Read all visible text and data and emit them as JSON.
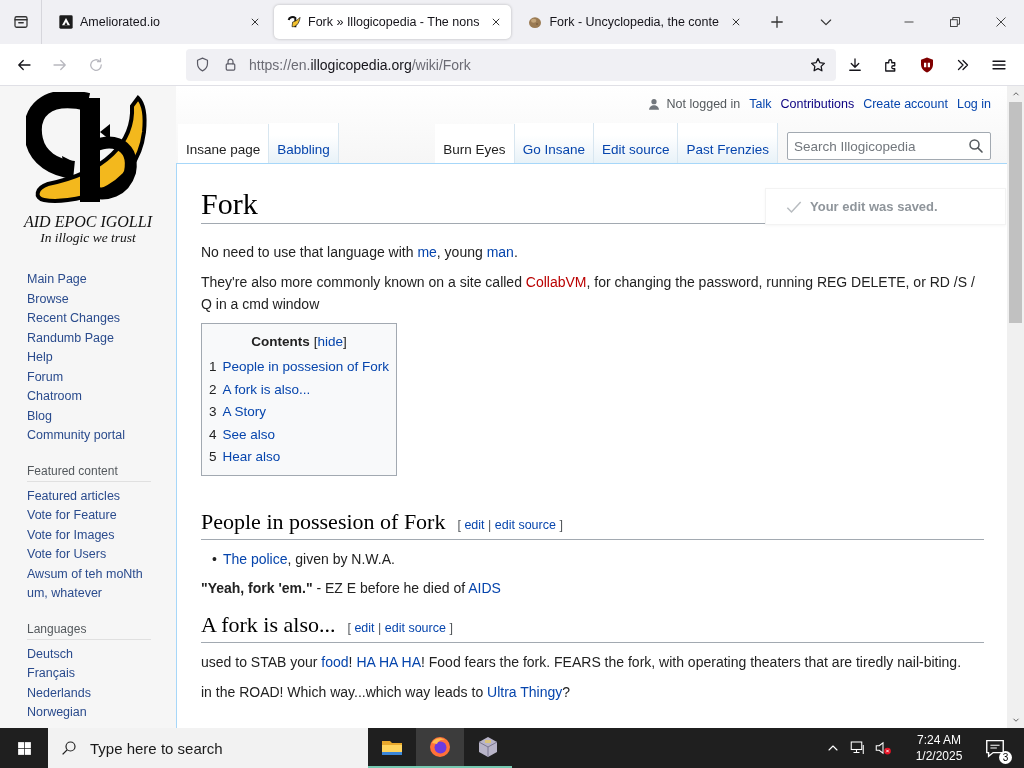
{
  "browser": {
    "tabs": [
      {
        "kind": "ameliorated",
        "title": "Ameliorated.io",
        "selected": false
      },
      {
        "kind": "illogicopedia",
        "title": "Fork » Illogicopedia - The nons",
        "selected": true
      },
      {
        "kind": "uncyclopedia",
        "title": "Fork - Uncyclopedia, the conte",
        "selected": false
      }
    ],
    "nav_buttons": [
      {
        "kind": "back",
        "disabled": false
      },
      {
        "kind": "forward",
        "disabled": true
      },
      {
        "kind": "reload",
        "disabled": true
      }
    ],
    "address": {
      "prefix": "https://en.",
      "domain": "illogicopedia.org",
      "path": "/wiki/Fork"
    }
  },
  "wiki": {
    "logo": {
      "title": "AID EPOC IGOLLI",
      "motto": "In illogic we trust"
    },
    "navigation": [
      "Main Page",
      "Browse",
      "Recent Changes",
      "Randumb Page",
      "Help",
      "Forum",
      "Chatroom",
      "Blog",
      "Community portal"
    ],
    "portlets": [
      {
        "heading": "Featured content",
        "items": [
          "Featured articles",
          "Vote for Feature",
          "Vote for Images",
          "Vote for Users",
          "Awsum of teh moNth",
          "um, whatever"
        ]
      },
      {
        "heading": "Languages",
        "items": [
          "Deutsch",
          "Français",
          "Nederlands",
          "Norwegian"
        ]
      }
    ],
    "personal": {
      "status": "Not logged in",
      "links": [
        {
          "label": "Talk",
          "visited": false
        },
        {
          "label": "Contributions",
          "visited": true
        },
        {
          "label": "Create account",
          "visited": false
        },
        {
          "label": "Log in",
          "visited": false
        }
      ]
    },
    "namespace_tabs": [
      {
        "label": "Insane page",
        "selected": true
      },
      {
        "label": "Babbling",
        "selected": false
      }
    ],
    "view_tabs": [
      {
        "label": "Burn Eyes",
        "selected": true
      },
      {
        "label": "Go Insane",
        "selected": false
      },
      {
        "label": "Edit source",
        "selected": false
      },
      {
        "label": "Past Frenzies",
        "selected": false
      }
    ],
    "search": {
      "placeholder": "Search Illogicopedia"
    },
    "notification": "Your edit was saved.",
    "article": {
      "title": "Fork",
      "blocks": [
        {
          "kind": "paragraph",
          "segments": [
            {
              "kind": "text",
              "text": "No need to use that language with "
            },
            {
              "kind": "link",
              "text": "me"
            },
            {
              "kind": "text",
              "text": ", young "
            },
            {
              "kind": "link",
              "text": "man"
            },
            {
              "kind": "text",
              "text": "."
            }
          ]
        },
        {
          "kind": "paragraph",
          "segments": [
            {
              "kind": "text",
              "text": "They're also more commonly known on a site called "
            },
            {
              "kind": "redlink",
              "text": "CollabVM"
            },
            {
              "kind": "text",
              "text": ", for changing the password, running REG DELETE, or RD /S / Q in a cmd window"
            }
          ]
        },
        {
          "kind": "toc",
          "title": "Contents",
          "toggle": {
            "open": "[",
            "label": "hide",
            "close": "]"
          },
          "items": [
            {
              "number": "1",
              "label": "People in possesion of Fork"
            },
            {
              "number": "2",
              "label": "A fork is also..."
            },
            {
              "number": "3",
              "label": "A Story"
            },
            {
              "number": "4",
              "label": "See also"
            },
            {
              "number": "5",
              "label": "Hear also"
            }
          ]
        },
        {
          "kind": "heading",
          "title": "People in possesion of Fork",
          "edit": {
            "open": "[",
            "links": [
              "edit",
              "edit source"
            ],
            "separator": "|",
            "close": "]"
          }
        },
        {
          "kind": "bullets",
          "items": [
            {
              "marker": "•",
              "segments": [
                {
                  "kind": "link",
                  "text": "The police"
                },
                {
                  "kind": "text",
                  "text": ", given by N.W.A."
                }
              ]
            }
          ]
        },
        {
          "kind": "paragraph",
          "segments": [
            {
              "kind": "bold",
              "text": "\"Yeah, fork 'em.\""
            },
            {
              "kind": "text",
              "text": " - EZ E before he died of "
            },
            {
              "kind": "link",
              "text": "AIDS"
            }
          ]
        },
        {
          "kind": "heading",
          "title": "A fork is also...",
          "edit": {
            "open": "[",
            "links": [
              "edit",
              "edit source"
            ],
            "separator": "|",
            "close": "]"
          }
        },
        {
          "kind": "paragraph",
          "segments": [
            {
              "kind": "text",
              "text": "used to STAB your "
            },
            {
              "kind": "link",
              "text": "food"
            },
            {
              "kind": "text",
              "text": "! "
            },
            {
              "kind": "link",
              "text": "HA HA HA"
            },
            {
              "kind": "text",
              "text": "! Food fears the fork. FEARS the fork, with operating theaters that are tiredly nail-biting."
            }
          ]
        },
        {
          "kind": "paragraph",
          "segments": [
            {
              "kind": "text",
              "text": "in the ROAD! Which way...which way leads to "
            },
            {
              "kind": "link",
              "text": "Ultra Thingy"
            },
            {
              "kind": "text",
              "text": "?"
            }
          ]
        }
      ]
    }
  },
  "taskbar": {
    "search_placeholder": "Type here to search",
    "apps": [
      {
        "kind": "explorer",
        "selected": false
      },
      {
        "kind": "firefox",
        "selected": true
      },
      {
        "kind": "cube",
        "selected": false
      }
    ],
    "time": "7:24 AM",
    "date": "1/2/2025",
    "notifications": "3"
  }
}
